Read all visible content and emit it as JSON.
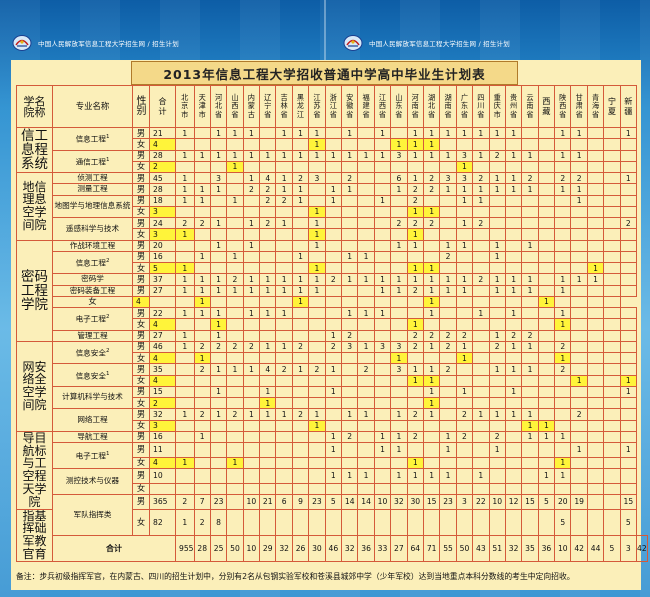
{
  "header": {
    "left_text": "中国人民解放军信息工程大学招生网 / 招生计划",
    "right_text": "中国人民解放军信息工程大学招生网 / 招生计划",
    "logo_icon": "university-emblem-icon"
  },
  "title": "2013年信息工程大学招收普通中学高中毕业生计划表",
  "headers": {
    "college": "学名院称",
    "major": "专业名称",
    "gender": "性别",
    "total": "合计",
    "provinces": [
      "北京市",
      "天津市",
      "河北省",
      "山西省",
      "内蒙古",
      "辽宁省",
      "吉林省",
      "黑龙江",
      "江苏省",
      "浙江省",
      "安徽省",
      "福建省",
      "江西省",
      "山东省",
      "河南省",
      "湖北省",
      "湖南省",
      "广东省",
      "四川省",
      "重庆市",
      "贵州省",
      "云南省",
      "西藏",
      "陕西省",
      "甘肃省",
      "青海省",
      "宁夏",
      "新疆"
    ]
  },
  "colleges": [
    {
      "name": "信工息程系统",
      "rows": 4
    },
    {
      "name": "地信理息空学间院",
      "rows": 6
    },
    {
      "name": "密码工程学院",
      "rows": 9
    },
    {
      "name": "网安络全空学间院",
      "rows": 8
    },
    {
      "name": "导目航标与工空程天学院",
      "rows": 6
    },
    {
      "name": "指基挥础军教官育",
      "rows": 2
    }
  ],
  "rows": [
    {
      "major": "信息工程",
      "sup": "1",
      "major_rows": 2,
      "gender": "男",
      "total": "21",
      "cells": [
        "1",
        "",
        "1",
        "1",
        "1",
        "",
        "1",
        "1",
        "1",
        "",
        "1",
        "",
        "1",
        "",
        "1",
        "1",
        "1",
        "1",
        "1",
        "1",
        "1",
        "",
        "",
        "1",
        "1",
        "",
        "",
        "1"
      ]
    },
    {
      "major": "",
      "gender": "女",
      "total": "4",
      "total_hl": true,
      "cells": [
        "",
        "",
        "",
        "",
        "",
        "",
        "",
        "",
        "1",
        "",
        "",
        "",
        "",
        "1",
        "1",
        "1",
        "",
        "",
        "",
        "",
        "",
        "",
        "",
        "",
        "",
        "",
        "",
        ""
      ],
      "hl": [
        8,
        13,
        14,
        15
      ]
    },
    {
      "major": "通信工程",
      "sup": "1",
      "major_rows": 2,
      "gender": "男",
      "total": "28",
      "cells": [
        "1",
        "1",
        "1",
        "1",
        "1",
        "1",
        "1",
        "1",
        "1",
        "1",
        "1",
        "1",
        "1",
        "3",
        "1",
        "1",
        "1",
        "3",
        "1",
        "2",
        "1",
        "1",
        "",
        "1",
        "1",
        "",
        "",
        ""
      ]
    },
    {
      "major": "",
      "gender": "女",
      "total": "2",
      "total_hl": true,
      "cells": [
        "",
        "",
        "",
        "1",
        "",
        "",
        "",
        "",
        "",
        "",
        "",
        "",
        "",
        "",
        "",
        "",
        "",
        "1",
        "",
        "",
        "",
        "",
        "",
        "",
        "",
        "",
        "",
        ""
      ],
      "hl": [
        3,
        17
      ]
    },
    {
      "major": "侦测工程",
      "major_rows": 1,
      "gender": "男",
      "total": "45",
      "cells": [
        "1",
        "",
        "3",
        "",
        "1",
        "4",
        "1",
        "2",
        "3",
        "",
        "2",
        "",
        "",
        "6",
        "1",
        "2",
        "3",
        "3",
        "2",
        "1",
        "1",
        "2",
        "",
        "2",
        "2",
        "",
        "",
        "1"
      ]
    },
    {
      "major": "测量工程",
      "major_rows": 1,
      "gender": "男",
      "total": "28",
      "cells": [
        "1",
        "1",
        "1",
        "",
        "2",
        "2",
        "1",
        "1",
        "",
        "1",
        "1",
        "",
        "",
        "1",
        "2",
        "2",
        "1",
        "1",
        "1",
        "1",
        "1",
        "1",
        "",
        "1",
        "1",
        "",
        "",
        ""
      ]
    },
    {
      "major": "地图学与地理信息系统",
      "major_rows": 2,
      "gender": "男",
      "total": "18",
      "cells": [
        "1",
        "1",
        "",
        "1",
        "",
        "2",
        "2",
        "1",
        "",
        "1",
        "",
        "",
        "1",
        "",
        "2",
        "",
        "",
        "1",
        "1",
        "",
        "",
        "",
        "",
        "",
        "1",
        "",
        "",
        ""
      ]
    },
    {
      "major": "",
      "gender": "女",
      "total": "3",
      "total_hl": true,
      "cells": [
        "",
        "",
        "",
        "",
        "",
        "",
        "",
        "",
        "1",
        "",
        "",
        "",
        "",
        "",
        "1",
        "1",
        "",
        "",
        "",
        "",
        "",
        "",
        "",
        "",
        "",
        "",
        "",
        ""
      ],
      "hl": [
        8,
        14,
        15
      ]
    },
    {
      "major": "遥感科学与技术",
      "major_rows": 2,
      "gender": "男",
      "total": "24",
      "cells": [
        "2",
        "2",
        "1",
        "",
        "1",
        "2",
        "1",
        "",
        "1",
        "",
        "",
        "",
        "",
        "2",
        "2",
        "2",
        "",
        "1",
        "2",
        "",
        "",
        "",
        "",
        "",
        "",
        "",
        "",
        "2"
      ]
    },
    {
      "major": "",
      "gender": "女",
      "total": "3",
      "total_hl": true,
      "cells": [
        "1",
        "",
        "",
        "",
        "",
        "",
        "",
        "",
        "1",
        "",
        "",
        "",
        "",
        "",
        "1",
        "",
        "",
        "",
        "",
        "",
        "",
        "",
        "",
        "",
        "",
        "",
        "",
        ""
      ],
      "hl": [
        0,
        8,
        14
      ]
    },
    {
      "major": "作战环境工程",
      "major_rows": 1,
      "gender": "男",
      "total": "20",
      "cells": [
        "",
        "",
        "1",
        "",
        "1",
        "",
        "",
        "",
        "1",
        "",
        "",
        "",
        "",
        "1",
        "1",
        "",
        "1",
        "1",
        "",
        "1",
        "",
        "1",
        "",
        "",
        "",
        "",
        "",
        ""
      ]
    },
    {
      "major": "信息工程",
      "sup": "2",
      "major_rows": 2,
      "gender": "男",
      "total": "16",
      "cells": [
        "",
        "1",
        "",
        "1",
        "",
        "",
        "",
        "1",
        "",
        "",
        "1",
        "1",
        "",
        "",
        "",
        "",
        "2",
        "",
        "",
        "1",
        "",
        "",
        "",
        "",
        "",
        "",
        "",
        ""
      ]
    },
    {
      "major": "",
      "gender": "女",
      "total": "5",
      "total_hl": true,
      "cells": [
        "1",
        "",
        "",
        "",
        "",
        "",
        "",
        "",
        "1",
        "",
        "",
        "",
        "",
        "",
        "1",
        "1",
        "",
        "",
        "",
        "",
        "",
        "",
        "",
        "",
        "",
        "1",
        "",
        ""
      ],
      "hl": [
        0,
        8,
        14,
        15,
        25
      ]
    },
    {
      "major": "密码学",
      "major_rows": 1,
      "gender": "男",
      "total": "37",
      "cells": [
        "1",
        "1",
        "1",
        "2",
        "1",
        "1",
        "1",
        "1",
        "1",
        "2",
        "1",
        "1",
        "1",
        "1",
        "1",
        "1",
        "1",
        "1",
        "2",
        "1",
        "1",
        "1",
        "",
        "1",
        "1",
        "1",
        "",
        ""
      ]
    },
    {
      "major": "密码装备工程",
      "major_rows": 1,
      "gender": "男",
      "total": "27",
      "cells": [
        "1",
        "1",
        "1",
        "1",
        "1",
        "1",
        "1",
        "1",
        "1",
        "",
        "",
        "",
        "1",
        "1",
        "2",
        "1",
        "1",
        "1",
        "",
        "1",
        "1",
        "1",
        "",
        "1",
        "",
        "",
        "",
        ""
      ]
    },
    {
      "major": "",
      "gender": "女",
      "total": "4",
      "total_hl": true,
      "cells": [
        "",
        "",
        "1",
        "",
        "",
        "",
        "",
        "",
        "1",
        "",
        "",
        "",
        "",
        "",
        "",
        "",
        "1",
        "",
        "",
        "",
        "",
        "",
        "",
        "1",
        "",
        "",
        "",
        ""
      ],
      "hl": [
        2,
        8,
        16,
        23
      ]
    },
    {
      "major": "电子工程",
      "sup": "2",
      "major_rows": 2,
      "gender": "男",
      "total": "22",
      "cells": [
        "1",
        "1",
        "1",
        "",
        "1",
        "1",
        "1",
        "",
        "",
        "",
        "1",
        "1",
        "1",
        "",
        "",
        "1",
        "",
        "",
        "1",
        "",
        "1",
        "",
        "",
        "1",
        "",
        "",
        "",
        ""
      ]
    },
    {
      "major": "",
      "gender": "女",
      "total": "4",
      "total_hl": true,
      "cells": [
        "",
        "",
        "1",
        "",
        "",
        "",
        "",
        "",
        "",
        "",
        "",
        "",
        "",
        "",
        "1",
        "",
        "",
        "",
        "",
        "",
        "",
        "",
        "",
        "1",
        "",
        "",
        "",
        ""
      ],
      "hl": [
        2,
        14,
        23
      ]
    },
    {
      "major": "管理工程",
      "major_rows": 1,
      "gender": "男",
      "total": "27",
      "cells": [
        "1",
        "",
        "1",
        "",
        "",
        "",
        "",
        "",
        "",
        "1",
        "2",
        "",
        "",
        "",
        "2",
        "2",
        "2",
        "2",
        "",
        "1",
        "2",
        "2",
        "",
        "",
        "",
        "",
        "",
        ""
      ]
    },
    {
      "major": "信息安全",
      "sup": "2",
      "major_rows": 2,
      "gender": "男",
      "total": "46",
      "cells": [
        "1",
        "2",
        "2",
        "2",
        "2",
        "1",
        "1",
        "2",
        "",
        "2",
        "3",
        "1",
        "3",
        "3",
        "2",
        "1",
        "2",
        "1",
        "",
        "2",
        "1",
        "1",
        "",
        "2",
        "",
        "",
        "",
        ""
      ]
    },
    {
      "major": "",
      "gender": "女",
      "total": "4",
      "total_hl": true,
      "cells": [
        "",
        "1",
        "",
        "",
        "",
        "",
        "",
        "",
        "",
        "",
        "",
        "",
        "",
        "1",
        "",
        "",
        "",
        "1",
        "",
        "",
        "",
        "",
        "",
        "1",
        "",
        "",
        "",
        ""
      ],
      "hl": [
        1,
        13,
        17,
        23
      ]
    },
    {
      "major": "信息安全",
      "sup": "1",
      "major_rows": 2,
      "gender": "男",
      "total": "35",
      "cells": [
        "",
        "2",
        "1",
        "1",
        "1",
        "4",
        "2",
        "1",
        "2",
        "1",
        "",
        "2",
        "",
        "3",
        "1",
        "1",
        "2",
        "",
        "",
        "1",
        "1",
        "1",
        "",
        "2",
        "",
        "",
        "",
        ""
      ]
    },
    {
      "major": "",
      "gender": "女",
      "total": "4",
      "total_hl": true,
      "cells": [
        "",
        "",
        "",
        "",
        "",
        "",
        "",
        "",
        "",
        "",
        "",
        "",
        "",
        "",
        "1",
        "1",
        "",
        "",
        "",
        "",
        "",
        "",
        "",
        "",
        "1",
        "",
        "",
        "1"
      ],
      "hl": [
        14,
        15,
        24,
        27
      ]
    },
    {
      "major": "计算机科学与技术",
      "major_rows": 2,
      "gender": "男",
      "total": "15",
      "cells": [
        "",
        "",
        "1",
        "",
        "",
        "1",
        "",
        "",
        "",
        "1",
        "",
        "",
        "",
        "",
        "",
        "1",
        "",
        "1",
        "",
        "",
        "1",
        "",
        "",
        "",
        "",
        "",
        "",
        "1"
      ]
    },
    {
      "major": "",
      "gender": "女",
      "total": "2",
      "total_hl": true,
      "cells": [
        "",
        "",
        "",
        "",
        "",
        "1",
        "",
        "",
        "",
        "",
        "",
        "",
        "",
        "",
        "",
        "1",
        "",
        "",
        "",
        "",
        "",
        "",
        "",
        "",
        "",
        "",
        "",
        ""
      ],
      "hl": [
        5,
        15
      ]
    },
    {
      "major": "网络工程",
      "major_rows": 2,
      "gender": "男",
      "total": "32",
      "cells": [
        "1",
        "2",
        "1",
        "2",
        "1",
        "1",
        "1",
        "2",
        "1",
        "",
        "1",
        "1",
        "",
        "1",
        "2",
        "1",
        "",
        "2",
        "1",
        "1",
        "1",
        "1",
        "",
        "",
        "2",
        "",
        "",
        ""
      ]
    },
    {
      "major": "",
      "gender": "女",
      "total": "3",
      "total_hl": true,
      "cells": [
        "",
        "",
        "",
        "",
        "",
        "",
        "",
        "",
        "1",
        "",
        "",
        "",
        "",
        "",
        "",
        "",
        "",
        "",
        "",
        "",
        "",
        "1",
        "1",
        "",
        "",
        "",
        "",
        ""
      ],
      "hl": [
        8,
        21,
        22
      ]
    },
    {
      "major": "导航工程",
      "major_rows": 1,
      "gender": "男",
      "total": "16",
      "cells": [
        "",
        "1",
        "",
        "",
        "",
        "",
        "",
        "",
        "",
        "1",
        "2",
        "",
        "1",
        "1",
        "2",
        "",
        "1",
        "2",
        "",
        "2",
        "",
        "1",
        "1",
        "1",
        "",
        "",
        "",
        ""
      ]
    },
    {
      "major": "电子工程",
      "sup": "1",
      "major_rows": 2,
      "gender": "男",
      "total": "11",
      "cells": [
        "",
        "",
        "",
        "",
        "",
        "",
        "",
        "",
        "",
        "1",
        "",
        "",
        "1",
        "1",
        "",
        "",
        "1",
        "",
        "",
        "1",
        "",
        "",
        "",
        "",
        "1",
        "",
        "",
        "1"
      ]
    },
    {
      "major": "",
      "gender": "女",
      "total": "4",
      "total_hl": true,
      "cells": [
        "1",
        "",
        "",
        "1",
        "",
        "",
        "",
        "",
        "",
        "",
        "",
        "",
        "",
        "",
        "1",
        "",
        "",
        "",
        "",
        "",
        "",
        "",
        "",
        "1",
        "",
        "",
        "",
        ""
      ],
      "hl": [
        0,
        3,
        14,
        23
      ]
    },
    {
      "major": "测控技术与仪器",
      "major_rows": 2,
      "gender": "男",
      "total": "10",
      "cells": [
        "",
        "",
        "",
        "",
        "",
        "",
        "",
        "",
        "",
        "1",
        "1",
        "1",
        "",
        "1",
        "1",
        "1",
        "1",
        "",
        "1",
        "",
        "",
        "",
        "1",
        "1",
        "",
        "",
        "",
        ""
      ]
    },
    {
      "major": "",
      "gender": "女",
      "total": "",
      "cells": [
        "",
        "",
        "",
        "",
        "",
        "",
        "",
        "",
        "",
        "",
        "",
        "",
        "",
        "",
        "",
        "",
        "",
        "",
        "",
        "",
        "",
        "",
        "",
        "",
        "",
        "",
        "",
        ""
      ]
    },
    {
      "major": "军队指挥类",
      "major_rows": 2,
      "gender": "男",
      "total": "365",
      "cells": [
        "2",
        "7",
        "23",
        "",
        "10",
        "21",
        "6",
        "9",
        "23",
        "5",
        "14",
        "14",
        "10",
        "32",
        "30",
        "15",
        "23",
        "3",
        "22",
        "10",
        "12",
        "15",
        "5",
        "20",
        "19",
        "",
        "",
        "15"
      ]
    },
    {
      "major": "",
      "gender": "女",
      "total": "82",
      "cells": [
        "1",
        "2",
        "8",
        "",
        "",
        "",
        "",
        "",
        "",
        "",
        "",
        "",
        "",
        "",
        "",
        "",
        "",
        "",
        "",
        "",
        "",
        "",
        "",
        "5",
        "",
        "",
        "",
        "5"
      ]
    },
    {
      "total_row": true,
      "label": "合计",
      "total": "955",
      "cells": [
        "",
        "",
        "",
        "",
        "",
        "",
        "",
        "",
        "",
        "",
        "",
        "",
        "",
        "",
        "",
        "",
        "",
        "",
        "",
        "",
        "",
        "",
        "",
        "",
        "",
        "",
        "",
        ""
      ]
    }
  ],
  "total_row_cells": [
    "28",
    "25",
    "50",
    "10",
    "29",
    "32",
    "26",
    "30",
    "46",
    "32",
    "36",
    "33",
    "27",
    "64",
    "71",
    "55",
    "50",
    "43",
    "51",
    "32",
    "35",
    "36",
    "10",
    "42",
    "44",
    "5",
    "3",
    "42"
  ],
  "note": "备注：步兵初级指挥军官，在内蒙古、四川的招生计划中，分别有2名从包钢实验军校和苍溪县城郊中学（少年军校）达到当地重点本科分数线的考生中定向招收。"
}
